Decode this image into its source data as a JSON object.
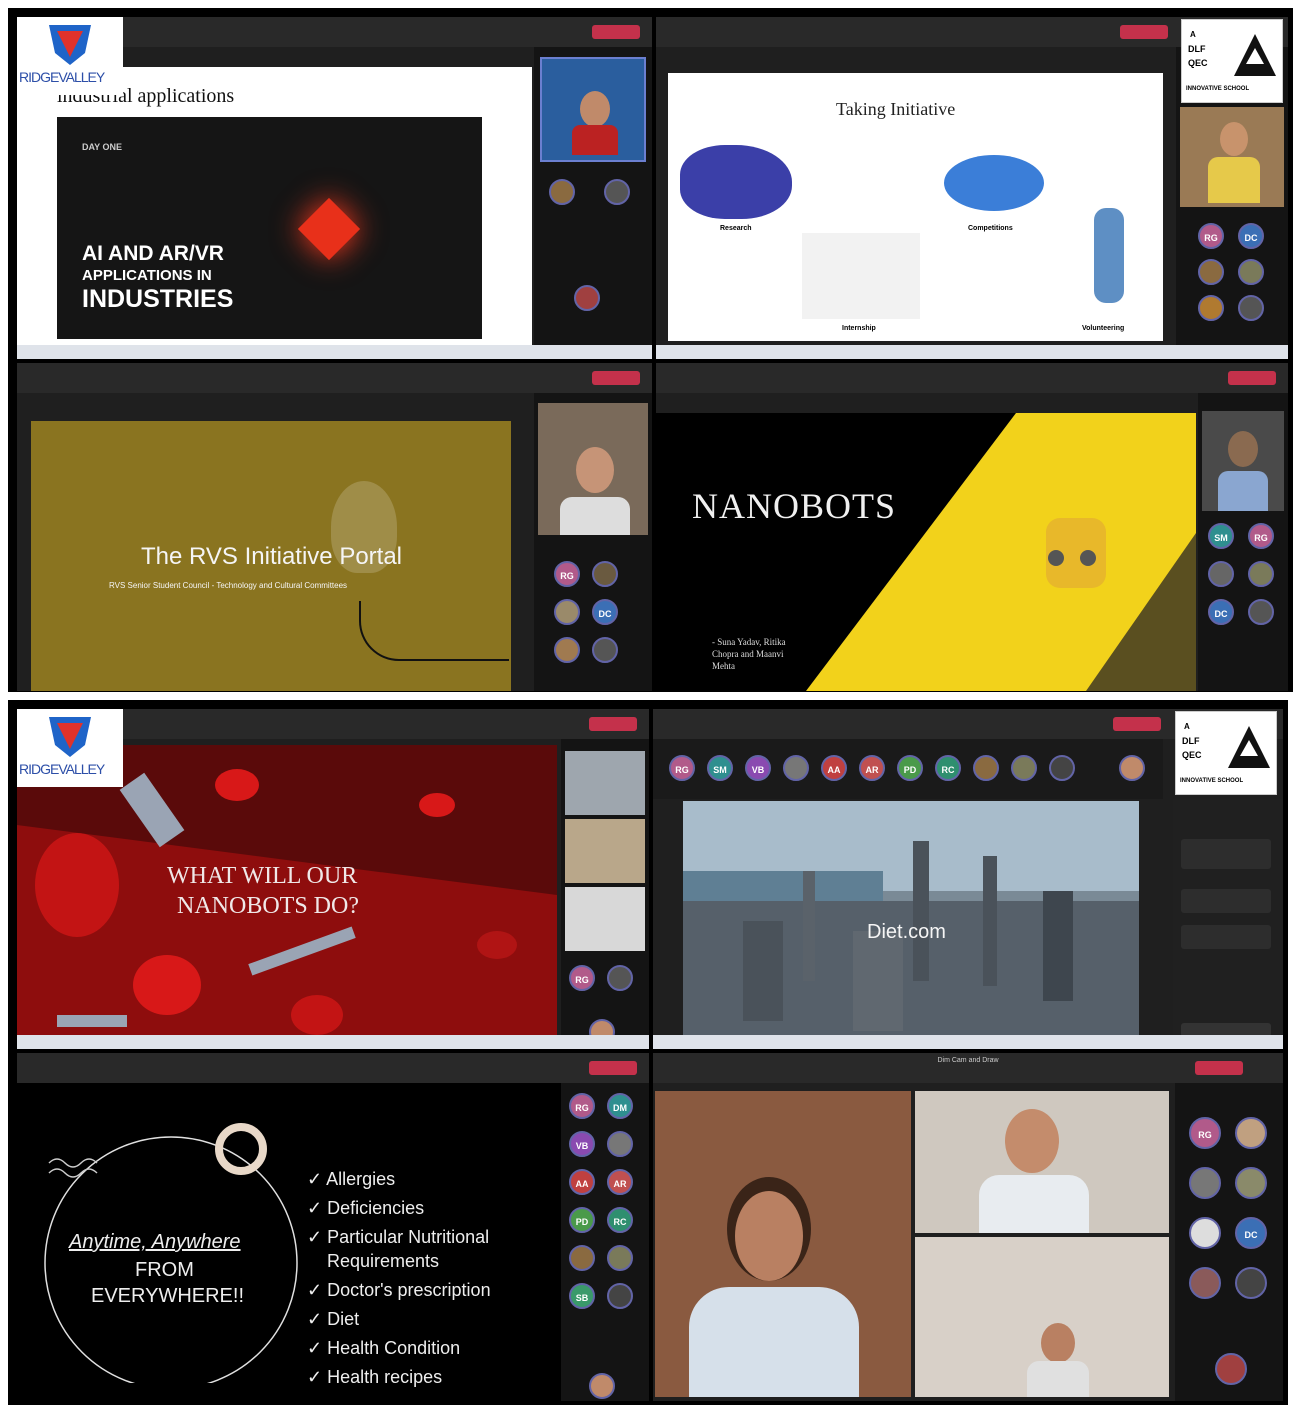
{
  "logos": {
    "ridge_valley": "RIDGEVALLEY",
    "dlf": [
      "A",
      "DLF",
      "QEC",
      "INNOVATIVE SCHOOL"
    ]
  },
  "panel1": {
    "slide_heading": "industrial applications",
    "video_day": "DAY ONE",
    "video_title_line1": "AI AND AR/VR",
    "video_title_line2": "APPLICATIONS IN",
    "video_title_line3": "INDUSTRIES"
  },
  "panel2": {
    "slide_title": "Taking Initiative",
    "labels": [
      "Research",
      "Competitions",
      "Internship",
      "Volunteering"
    ],
    "participants": [
      "RG",
      "DC"
    ]
  },
  "panel3": {
    "slide_title": "The RVS Initiative Portal",
    "slide_subtitle": "RVS Senior Student Council - Technology and Cultural Committees",
    "participants": [
      "RG",
      "DC"
    ]
  },
  "panel4": {
    "slide_title": "NANOBOTS",
    "credits": [
      "- Suna Yadav, Ritika",
      "Chopra and Maanvi",
      "Mehta"
    ],
    "participants": [
      "SM",
      "RG",
      "DC"
    ]
  },
  "panel5": {
    "slide_title_line1": "WHAT WILL OUR",
    "slide_title_line2": "NANOBOTS DO?",
    "participants": [
      "RG"
    ]
  },
  "panel6": {
    "slide_title": "Diet.com",
    "participants": [
      "RG",
      "SM",
      "VB",
      "AA",
      "AR",
      "PD",
      "RC"
    ]
  },
  "panel7": {
    "tagline_line1": "Anytime, Anywhere",
    "tagline_line2": "FROM",
    "tagline_line3": "EVERYWHERE!!",
    "checklist": [
      "✓ Allergies",
      "✓ Deficiencies",
      "✓ Particular Nutritional",
      "Requirements",
      "✓ Doctor's prescription",
      "✓ Diet",
      "✓ Health Condition",
      "✓ Health recipes"
    ],
    "participants": [
      "RG",
      "DM",
      "VB",
      "AA",
      "AR",
      "PD",
      "RC",
      "SB"
    ]
  },
  "panel8": {
    "window_title": "Dim Cam and Draw",
    "participants": [
      "RG",
      "DC"
    ]
  },
  "colors": {
    "teams_dark": "#1f1f1f",
    "leave_red": "#c4314b",
    "slide_gold": "#8a7420",
    "nanobots_yellow": "#f2d21b",
    "blood_red": "#8e0d0d"
  }
}
